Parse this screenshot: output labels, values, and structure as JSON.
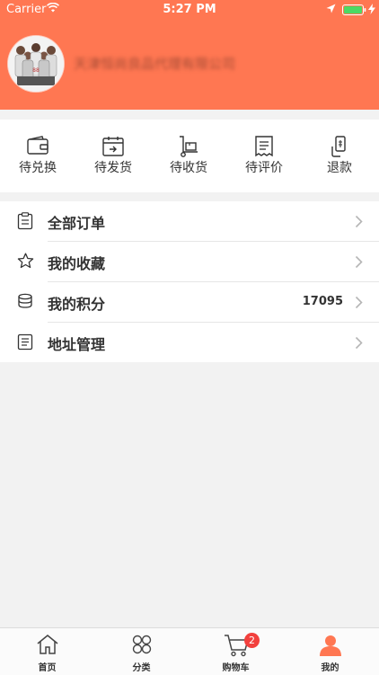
{
  "status_bar": {
    "carrier": "Carrier",
    "time": "5:27 PM"
  },
  "profile": {
    "company_name": "天津恒尚良品代理有限公司"
  },
  "order_shortcuts": [
    {
      "label": "待兑换",
      "icon": "wallet-icon"
    },
    {
      "label": "待发货",
      "icon": "calendar-icon"
    },
    {
      "label": "待收货",
      "icon": "hand-truck-icon"
    },
    {
      "label": "待评价",
      "icon": "receipt-icon"
    },
    {
      "label": "退款",
      "icon": "refund-phone-icon"
    }
  ],
  "menu": [
    {
      "label": "全部订单",
      "icon": "clipboard-icon",
      "value": ""
    },
    {
      "label": "我的收藏",
      "icon": "star-icon",
      "value": ""
    },
    {
      "label": "我的积分",
      "icon": "coins-icon",
      "value": "17095"
    },
    {
      "label": "地址管理",
      "icon": "list-icon",
      "value": ""
    }
  ],
  "tabbar": {
    "tabs": [
      {
        "label": "首页",
        "icon": "home-icon"
      },
      {
        "label": "分类",
        "icon": "category-icon"
      },
      {
        "label": "购物车",
        "icon": "cart-icon"
      },
      {
        "label": "我的",
        "icon": "profile-icon"
      }
    ],
    "cart_badge": "2",
    "active_color": "#ff7752"
  },
  "colors": {
    "header": "#ff7752",
    "badge": "#f2403d"
  }
}
